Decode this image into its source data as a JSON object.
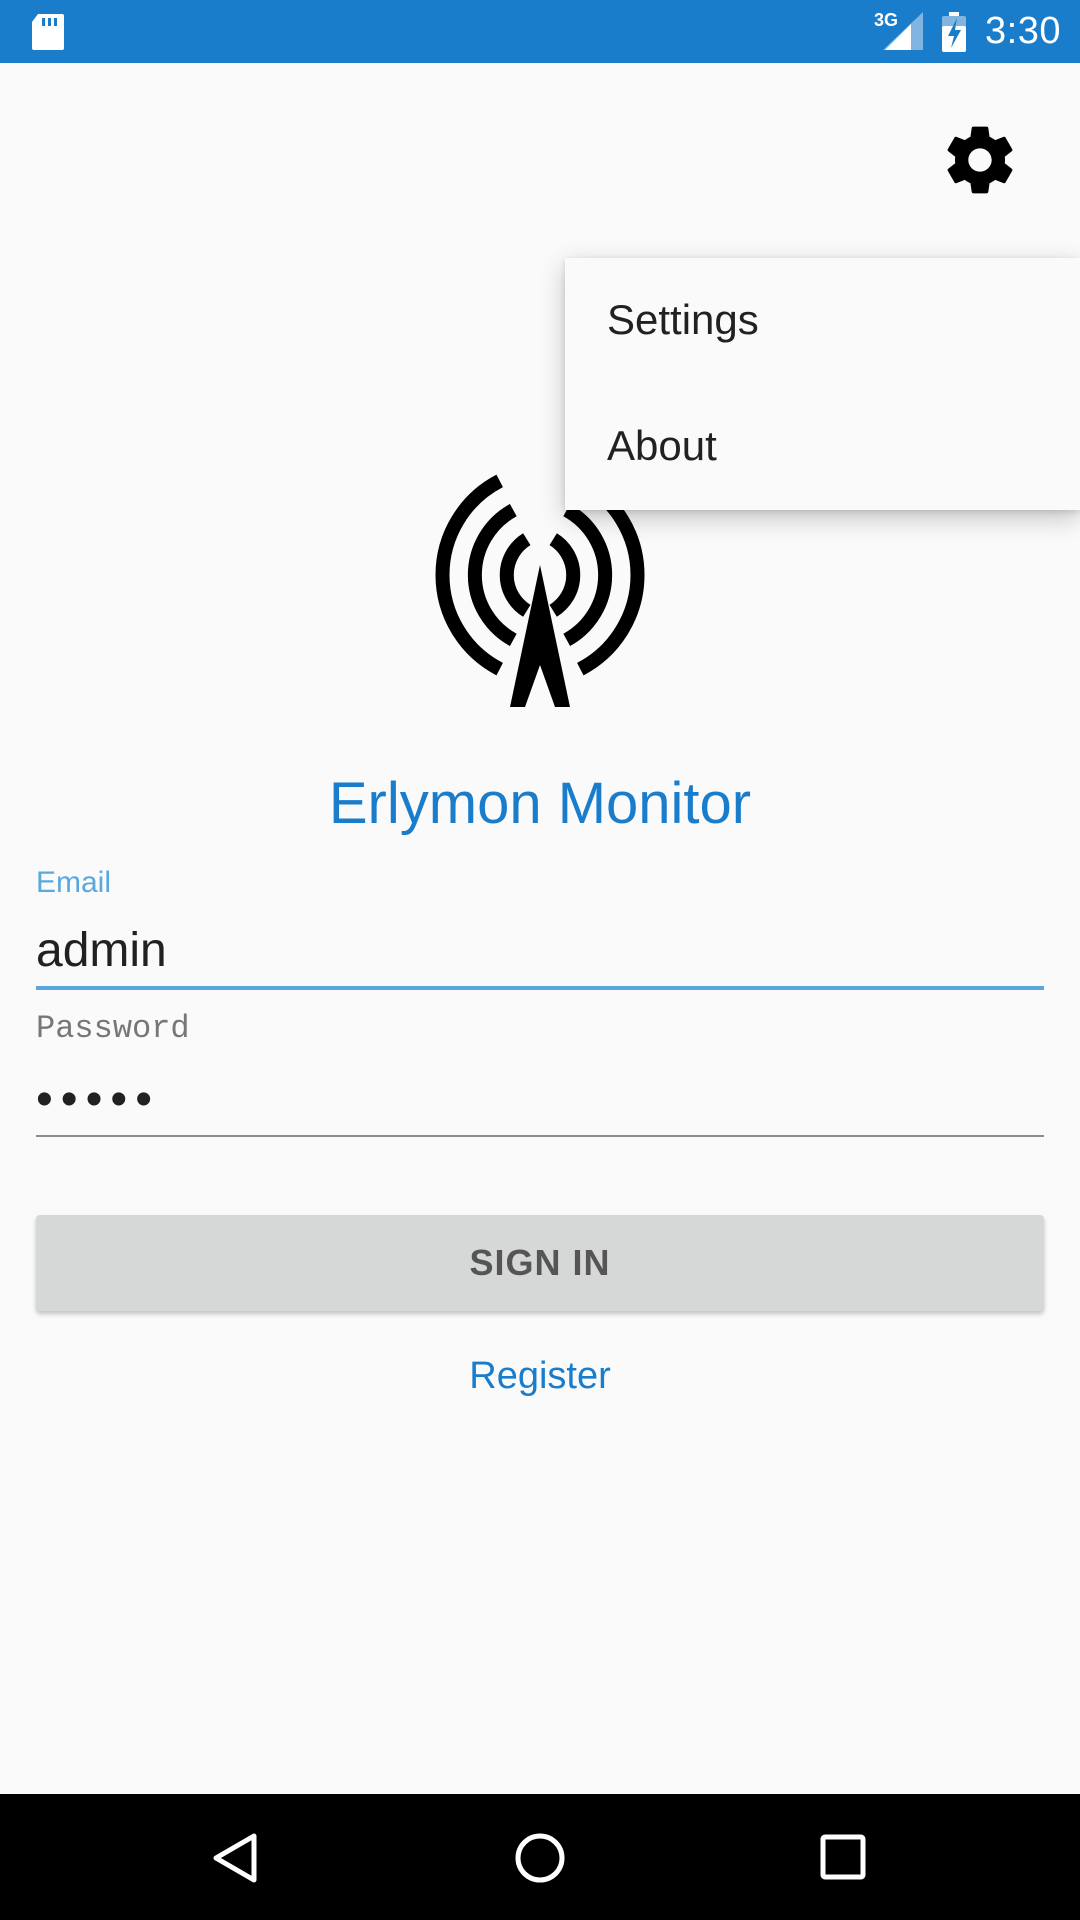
{
  "status_bar": {
    "network_type": "3G",
    "time": "3:30",
    "icons": [
      "sd-card-icon",
      "signal-icon",
      "battery-charging-icon"
    ]
  },
  "toolbar": {
    "settings_icon": "gear-icon"
  },
  "overflow_menu": {
    "items": [
      {
        "label": "Settings"
      },
      {
        "label": "About"
      }
    ]
  },
  "app": {
    "logo_icon": "radio-tower-icon",
    "title": "Erlymon Monitor"
  },
  "login_form": {
    "email": {
      "label": "Email",
      "value": "admin"
    },
    "password": {
      "label": "Password",
      "masked_value": "•••••"
    },
    "sign_in_label": "SIGN IN",
    "register_label": "Register"
  },
  "colors": {
    "accent": "#1a7dcb",
    "focused_field": "#5aa8dd",
    "button_bg": "#d6d7d7",
    "background": "#fafafa"
  },
  "nav_bar": {
    "icons": [
      "back-icon",
      "home-icon",
      "recents-icon"
    ]
  }
}
